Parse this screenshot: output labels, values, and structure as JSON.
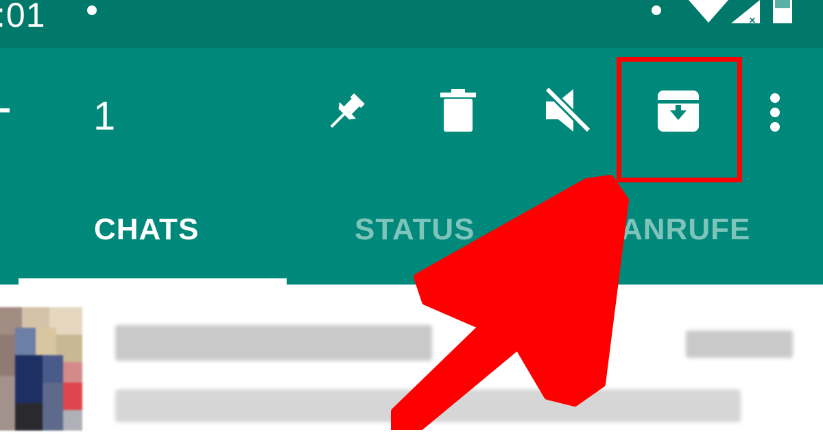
{
  "status_bar": {
    "time": ":01"
  },
  "toolbar": {
    "selected_count": "1",
    "icons": [
      "back-arrow-icon",
      "pin-icon",
      "delete-icon",
      "mute-icon",
      "archive-icon",
      "more-options-icon"
    ]
  },
  "tabs": [
    {
      "label": "CHATS",
      "active": true
    },
    {
      "label": "STATUS",
      "active": false
    },
    {
      "label": "ANRUFE",
      "active": false
    }
  ],
  "colors": {
    "status_bar": "#00796b",
    "toolbar": "#00897b",
    "inactive_tab": "#7fc4bb",
    "highlight": "#ff0000",
    "annotation_arrow": "#ff0000"
  }
}
